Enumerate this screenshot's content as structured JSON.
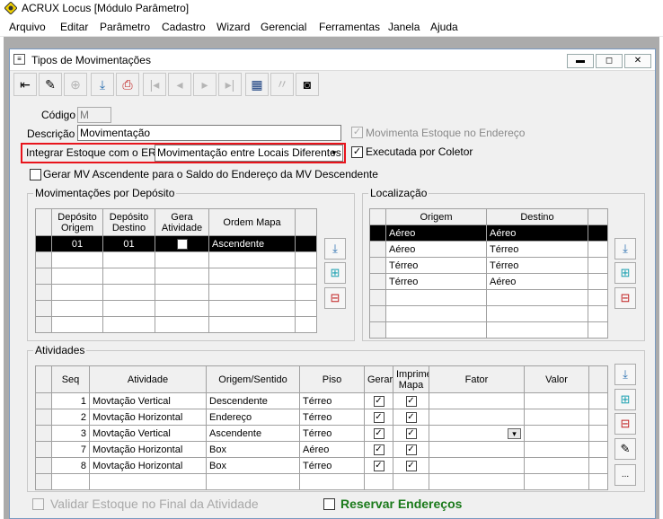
{
  "app": {
    "title": "ACRUX Locus [Módulo Parâmetro]"
  },
  "menu": [
    "Arquivo",
    "Editar",
    "Parâmetro",
    "Cadastro",
    "Wizard",
    "Gerencial",
    "Ferramentas",
    "Janela",
    "Ajuda"
  ],
  "window": {
    "title": "Tipos de Movimentações",
    "min": "▬",
    "restore": "◻",
    "close": "✕"
  },
  "toolbar": {
    "exit": "⇤",
    "edit": "✎",
    "copy": "⊕",
    "save": "⤓",
    "print": "⎙",
    "first": "|◂",
    "prev": "◂",
    "next": "▸",
    "last": "▸|",
    "film": "▦",
    "quote": "〃",
    "camera": "◙"
  },
  "form": {
    "codigo_label": "Código",
    "codigo_value": "M",
    "descricao_label": "Descrição",
    "descricao_value": "Movimentação",
    "movimenta_estoque_label": "Movimenta Estoque no Endereço",
    "movimenta_estoque_checked": "✓",
    "integrar_label": "Integrar Estoque com o ERP",
    "integrar_value": "Movimentação entre Locais Diferentes",
    "dropdown_arrow": "▼",
    "executada_label": "Executada por Coletor",
    "executada_checked": "✓",
    "gerar_mv_label": "Gerar MV Ascendente para o Saldo do Endereço da MV Descendente"
  },
  "depositos": {
    "title": "Movimentações por Depósito",
    "headers": [
      "Depósito Origem",
      "Depósito Destino",
      "Gera Atividade",
      "Ordem Mapa"
    ],
    "rows": [
      [
        "01",
        "01",
        "✓",
        "Ascendente"
      ]
    ]
  },
  "localizacao": {
    "title": "Localização",
    "headers": [
      "Origem",
      "Destino"
    ],
    "rows": [
      [
        "Aéreo",
        "Aéreo"
      ],
      [
        "Aéreo",
        "Térreo"
      ],
      [
        "Térreo",
        "Térreo"
      ],
      [
        "Térreo",
        "Aéreo"
      ]
    ]
  },
  "atividades": {
    "title": "Atividades",
    "headers": [
      "Seq",
      "Atividade",
      "Origem/Sentido",
      "Piso",
      "Gerar",
      "Imprime Mapa",
      "Fator",
      "Valor"
    ],
    "rows": [
      [
        "1",
        "Movtação Vertical",
        "Descendente",
        "Térreo",
        "✓",
        "✓",
        "",
        ""
      ],
      [
        "2",
        "Movtação Horizontal",
        "Endereço",
        "Térreo",
        "✓",
        "✓",
        "",
        ""
      ],
      [
        "3",
        "Movtação Vertical",
        "Ascendente",
        "Térreo",
        "✓",
        "✓",
        "▾",
        ""
      ],
      [
        "7",
        "Movtação Horizontal",
        "Box",
        "Aéreo",
        "✓",
        "✓",
        "",
        ""
      ],
      [
        "8",
        "Movtação Horizontal",
        "Box",
        "Térreo",
        "✓",
        "✓",
        "",
        ""
      ]
    ]
  },
  "side_icons": {
    "add": "⤓",
    "insert": "⊞",
    "delete": "⊟",
    "edit": "✎",
    "more": "..."
  },
  "bottom": {
    "validar_label": "Validar Estoque no Final da Atividade",
    "reservar_label": "Reservar Endereços"
  },
  "colors": {
    "highlight": "#e8141c",
    "reservar_text": "#1a7a1a"
  }
}
